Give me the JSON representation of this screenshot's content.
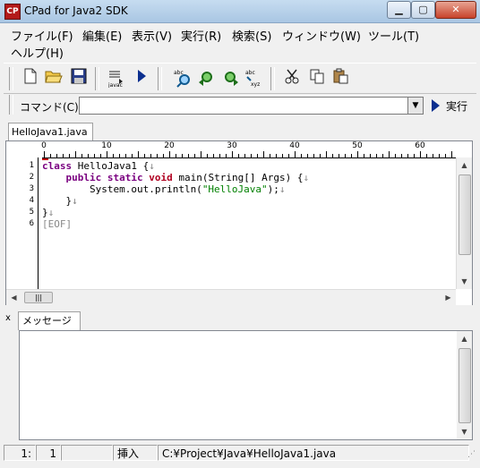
{
  "window": {
    "title": "CPad for Java2 SDK",
    "icon_label": "CP"
  },
  "menu": [
    {
      "label": "ファイル(F)"
    },
    {
      "label": "編集(E)"
    },
    {
      "label": "表示(V)"
    },
    {
      "label": "実行(R)"
    },
    {
      "label": "検索(S)"
    },
    {
      "label": "ウィンドウ(W)"
    },
    {
      "label": "ツール(T)"
    },
    {
      "label": "ヘルプ(H)"
    }
  ],
  "toolbar": {
    "icons": [
      "new-file-icon",
      "open-folder-icon",
      "save-disk-icon",
      "compile-icon",
      "run-icon",
      "find-icon",
      "find-next-icon",
      "find-prev-icon",
      "replace-icon",
      "cut-icon",
      "copy-icon",
      "paste-icon"
    ]
  },
  "command": {
    "label": "コマンド(C)",
    "value": "",
    "run_label": "実行"
  },
  "editor": {
    "tab_label": "HelloJava1.java",
    "ruler_labels": [
      "0",
      "10",
      "20",
      "30",
      "40",
      "50",
      "60"
    ],
    "line_numbers": [
      "1",
      "2",
      "3",
      "4",
      "5",
      "6"
    ],
    "code": {
      "l1_kw": "class",
      "l1_rest": " HelloJava1 {",
      "l2_indent": "    ",
      "l2_kw1": "public",
      "l2_sp1": " ",
      "l2_kw2": "static",
      "l2_sp2": " ",
      "l2_kw3": "void",
      "l2_rest": " main(String[] Args) {",
      "l3_pre": "        System.out.println(",
      "l3_str": "\"HelloJava\"",
      "l3_post": ");",
      "l4": "    }",
      "l5": "}",
      "l6": "[EOF]",
      "eol": "↓"
    }
  },
  "messages": {
    "tab_label": "メッセージ",
    "close_glyph": "x"
  },
  "status": {
    "line": "1",
    "col": "1",
    "mode": "挿入",
    "path": "C:¥Project¥Java¥HelloJava1.java"
  }
}
